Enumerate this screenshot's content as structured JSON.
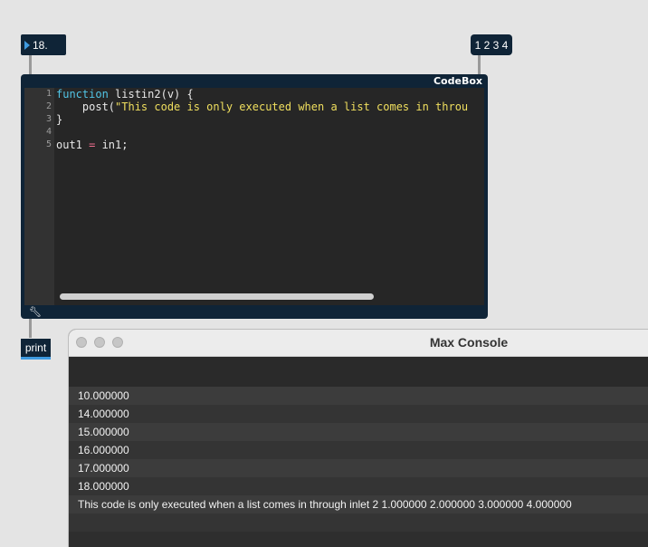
{
  "number_box": {
    "value": "18."
  },
  "message_box": {
    "text": "1 2 3 4"
  },
  "codebox": {
    "title": "CodeBox",
    "lines": [
      {
        "num": "1",
        "parts": [
          {
            "t": "function",
            "c": "kw"
          },
          {
            "t": " listin2(v) {",
            "c": ""
          }
        ]
      },
      {
        "num": "2",
        "parts": [
          {
            "t": "    post(",
            "c": ""
          },
          {
            "t": "\"This code is only executed when a list comes in throu",
            "c": "str"
          }
        ]
      },
      {
        "num": "3",
        "parts": [
          {
            "t": "}",
            "c": ""
          }
        ]
      },
      {
        "num": "4",
        "parts": []
      },
      {
        "num": "5",
        "parts": [
          {
            "t": "out1 ",
            "c": ""
          },
          {
            "t": "=",
            "c": "op"
          },
          {
            "t": " in1;",
            "c": ""
          }
        ]
      }
    ]
  },
  "print_object": {
    "label": "print"
  },
  "console": {
    "title": "Max Console",
    "rows": [
      "10.000000",
      "14.000000",
      "15.000000",
      "16.000000",
      "17.000000",
      "18.000000",
      "This code is only executed when a list comes in through inlet 2 1.000000 2.000000 3.000000 4.000000",
      ""
    ]
  }
}
